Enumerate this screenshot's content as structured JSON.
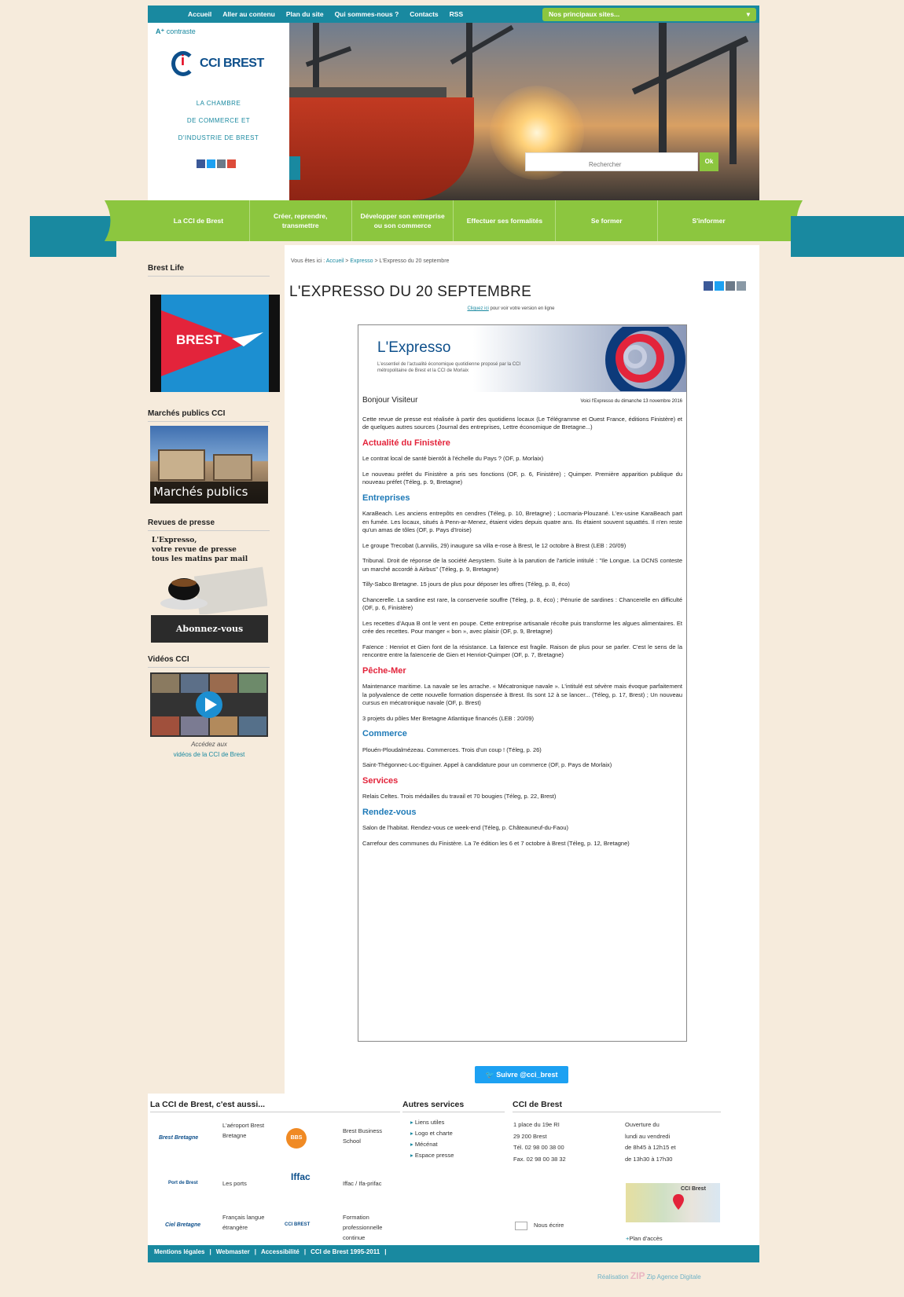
{
  "topnav": {
    "links": [
      "Accueil",
      "Aller au contenu",
      "Plan du site",
      "Qui sommes-nous ?",
      "Contacts",
      "RSS"
    ],
    "sites_label": "Nos principaux sites...",
    "sites_arrow": "▾"
  },
  "header": {
    "contrast": "contraste",
    "logo_text": "CCI BREST",
    "tagline": [
      "LA CHAMBRE",
      "DE COMMERCE ET",
      "D'INDUSTRIE DE BREST"
    ],
    "search_placeholder": "Rechercher",
    "search_button": "Ok"
  },
  "mainnav": [
    "La CCI de Brest",
    "Créer, reprendre, transmettre",
    "Développer son entreprise ou son commerce",
    "Effectuer ses formalités",
    "Se former",
    "S'informer"
  ],
  "sidebar": {
    "brest_life": {
      "title": "Brest Life",
      "banner": "BREST"
    },
    "marches": {
      "title": "Marchés publics CCI",
      "caption": "Marchés publics"
    },
    "revues": {
      "title": "Revues de presse",
      "lines": [
        "L'Expresso,",
        "votre revue de presse",
        "tous les matins par mail"
      ],
      "button": "Abonnez-vous"
    },
    "videos": {
      "title": "Vidéos CCI",
      "caption1": "Accédez aux",
      "caption2": "vidéos de la CCI de Brest"
    }
  },
  "breadcrumb": {
    "prefix": "Vous êtes ici :",
    "home": "Accueil",
    "cat": "Expresso",
    "current": "L'Expresso du 20 septembre",
    "sep": ">"
  },
  "page_title": "L'EXPRESSO DU 20 SEPTEMBRE",
  "online": {
    "link": "Cliquez ici",
    "rest": " pour voir votre version en ligne"
  },
  "newsletter": {
    "brand": "L'Expresso",
    "sub": "L'essentiel de l'actualité économique quotidienne proposé par la CCI métropolitaine de Brest et la CCI de Morlaix",
    "greeting": "Bonjour Visiteur",
    "edition": "Voici l'Expresso du dimanche 13 novembre 2016",
    "intro": "Cette revue de presse est réalisée à partir des quotidiens locaux (Le Télégramme et Ouest France, éditions Finistère) et de quelques autres sources (Journal des entreprises, Lettre économique de Bretagne...)",
    "sections": [
      {
        "title": "Actualité du Finistère",
        "color": "red",
        "items": [
          "Le contrat local de santé bientôt à l'échelle du Pays ? (OF, p. Morlaix)",
          "Le nouveau préfet du Finistère a pris ses fonctions (OF, p. 6, Finistère) ; Quimper. Première apparition publique du nouveau préfet (Téleg, p. 9, Bretagne)"
        ]
      },
      {
        "title": "Entreprises",
        "color": "blue",
        "items": [
          "KaraBeach. Les anciens entrepôts en cendres (Téleg, p. 10, Bretagne) ; Locmaria-Plouzané. L'ex-usine KaraBeach part en fumée. Les locaux, situés à Penn-ar-Menez, étaient vides depuis quatre ans. Ils étaient souvent squattés. Il n'en reste qu'un amas de tôles (OF, p. Pays d'Iroise)",
          "Le groupe Trecobat (Lannilis, 29) inaugure sa villa e-rose à Brest, le 12 octobre à Brest (LEB : 20/09)",
          "Tribunal. Droit de réponse de la société Aesystem. Suite à la parution de l'article intitulé : \"Ile Longue. La DCNS conteste un marché accordé à Airbus\" (Téleg, p. 9, Bretagne)",
          "Tilly-Sabco Bretagne. 15 jours de plus pour déposer les offres (Téleg, p. 8, éco)",
          "Chancerelle. La sardine est rare, la conserverie souffre (Téleg, p. 8, éco) ; Pénurie de sardines : Chancerelle en difficulté (OF, p. 6, Finistère)",
          "Les recettes d'Aqua B ont le vent en poupe. Cette entreprise artisanale récolte puis transforme les algues alimentaires. Et crée des recettes. Pour manger « bon », avec plaisir (OF, p. 9, Bretagne)",
          "Faïence : Henriot et Gien font de la résistance. La faïence est fragile. Raison de plus pour se parler. C'est le sens de la rencontre entre la faïencerie de Gien et Henriot-Quimper (OF, p. 7, Bretagne)"
        ]
      },
      {
        "title": "Pêche-Mer",
        "color": "red",
        "items": [
          "Maintenance maritime. La navale se les arrache. « Mécatronique navale ». L'intitulé est sévère mais évoque parfaitement la polyvalence de cette nouvelle formation dispensée à Brest. Ils sont 12 à se lancer... (Téleg, p. 17, Brest) ; Un nouveau cursus en mécatronique navale (OF, p. Brest)",
          "3 projets du pôles Mer Bretagne Atlantique financés (LEB : 20/09)"
        ]
      },
      {
        "title": "Commerce",
        "color": "blue",
        "items": [
          "Plouén-Ploudalmézeau. Commerces. Trois d'un coup ! (Téleg, p. 26)",
          "Saint-Thégonnec-Loc-Eguiner. Appel à candidature pour un commerce (OF, p. Pays de Morlaix)"
        ]
      },
      {
        "title": "Services",
        "color": "red",
        "items": [
          "Relais Celtes. Trois médailles du travail et 70 bougies (Téleg, p. 22, Brest)"
        ]
      },
      {
        "title": "Rendez-vous",
        "color": "blue",
        "items": [
          "Salon de l'habitat. Rendez-vous ce week-end (Téleg, p. Châteauneuf-du-Faou)",
          "Carrefour des communes du Finistère. La 7e édition les 6 et 7 octobre à Brest (Téleg, p. 12, Bretagne)"
        ]
      }
    ]
  },
  "follow_button": "Suivre @cci_brest",
  "footer": {
    "aussi_title": "La CCI de Brest, c'est aussi...",
    "aussi": [
      {
        "logo": "Brest Bretagne",
        "label": "L'aéroport Brest Bretagne"
      },
      {
        "logo": "BBS",
        "label": "Brest Business School"
      },
      {
        "logo": "Port de Brest",
        "label": "Les ports"
      },
      {
        "logo": "Iffac",
        "label": "Iffac / Ifa-prifac"
      },
      {
        "logo": "Ciel Bretagne",
        "label": "Français langue étrangère"
      },
      {
        "logo": "CCI BREST",
        "label": "Formation professionnelle continue"
      }
    ],
    "services_title": "Autres services",
    "services": [
      "Liens utiles",
      "Logo et charte",
      "Mécénat",
      "Espace presse"
    ],
    "cci_title": "CCI de Brest",
    "address": [
      "1 place du 19e RI",
      "29 200 Brest",
      "Tél. 02 98 00 38 00",
      "Fax. 02 98 00 38 32"
    ],
    "hours": [
      "Ouverture du",
      "lundi au vendredi",
      "de 8h45 à 12h15 et",
      "de 13h30 à 17h30"
    ],
    "write": "Nous écrire",
    "map_label": "CCI Brest",
    "plan": "Plan d'accès"
  },
  "bottombar": [
    "Mentions légales",
    "|",
    "Webmaster",
    "|",
    "Accessibilité",
    "|",
    "CCI de Brest 1995-2011",
    "|"
  ],
  "credit": {
    "pre": "Réalisation",
    "zip": "ZIP",
    "post": "Zip Agence Digitale"
  },
  "colors": {
    "teal": "#1989a0",
    "green": "#8cc63f",
    "red": "#e3243b",
    "blue": "#1e7ab8",
    "navy": "#0d4f8b"
  }
}
